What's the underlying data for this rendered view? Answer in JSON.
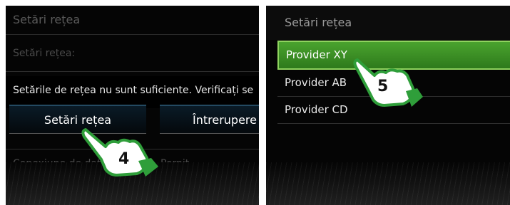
{
  "left_screen": {
    "header_title": "Setări rețea",
    "subheader": "Setări rețea:",
    "message": "Setările de rețea nu sunt suficiente. Verificați se",
    "buttons": {
      "network_settings": "Setări rețea",
      "interrupt": "Întrerupere"
    },
    "setting": {
      "label": "Conexiune de date",
      "value": "Pornit"
    },
    "step_number": "4"
  },
  "right_screen": {
    "header_title": "Setări rețea",
    "providers": [
      "Provider XY",
      "Provider AB",
      "Provider CD"
    ],
    "selected_index": 0,
    "step_number": "5"
  },
  "colors": {
    "selection_green": "#3d9a27",
    "hand_green": "#2f9e3a",
    "button_top": "#244a62"
  },
  "icons": [
    "pointing-hand-icon"
  ]
}
